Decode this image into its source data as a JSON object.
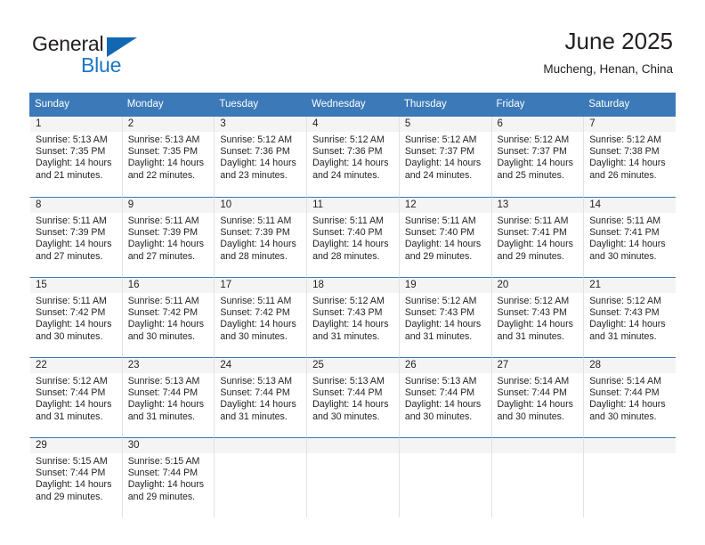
{
  "brand": {
    "name_top": "General",
    "name_bottom": "Blue",
    "top_color": "#231f20",
    "bottom_color": "#1b76c4",
    "triangle_color": "#1267b2",
    "icon": "triangle-flag-icon"
  },
  "header": {
    "title": "June 2025",
    "subtitle": "Mucheng, Henan, China"
  },
  "theme": {
    "header_bg": "#3b79b8",
    "header_text": "#ffffff",
    "daynum_bg": "#f4f4f4",
    "cell_bg": "#ffffff",
    "cell_border": "#e2e2e2",
    "week_border": "#3b79b8",
    "text": "#231f20"
  },
  "weekdays": [
    "Sunday",
    "Monday",
    "Tuesday",
    "Wednesday",
    "Thursday",
    "Friday",
    "Saturday"
  ],
  "weeks": [
    [
      {
        "day": "1",
        "sunrise": "Sunrise: 5:13 AM",
        "sunset": "Sunset: 7:35 PM",
        "daylight_1": "Daylight: 14 hours",
        "daylight_2": "and 21 minutes."
      },
      {
        "day": "2",
        "sunrise": "Sunrise: 5:13 AM",
        "sunset": "Sunset: 7:35 PM",
        "daylight_1": "Daylight: 14 hours",
        "daylight_2": "and 22 minutes."
      },
      {
        "day": "3",
        "sunrise": "Sunrise: 5:12 AM",
        "sunset": "Sunset: 7:36 PM",
        "daylight_1": "Daylight: 14 hours",
        "daylight_2": "and 23 minutes."
      },
      {
        "day": "4",
        "sunrise": "Sunrise: 5:12 AM",
        "sunset": "Sunset: 7:36 PM",
        "daylight_1": "Daylight: 14 hours",
        "daylight_2": "and 24 minutes."
      },
      {
        "day": "5",
        "sunrise": "Sunrise: 5:12 AM",
        "sunset": "Sunset: 7:37 PM",
        "daylight_1": "Daylight: 14 hours",
        "daylight_2": "and 24 minutes."
      },
      {
        "day": "6",
        "sunrise": "Sunrise: 5:12 AM",
        "sunset": "Sunset: 7:37 PM",
        "daylight_1": "Daylight: 14 hours",
        "daylight_2": "and 25 minutes."
      },
      {
        "day": "7",
        "sunrise": "Sunrise: 5:12 AM",
        "sunset": "Sunset: 7:38 PM",
        "daylight_1": "Daylight: 14 hours",
        "daylight_2": "and 26 minutes."
      }
    ],
    [
      {
        "day": "8",
        "sunrise": "Sunrise: 5:11 AM",
        "sunset": "Sunset: 7:39 PM",
        "daylight_1": "Daylight: 14 hours",
        "daylight_2": "and 27 minutes."
      },
      {
        "day": "9",
        "sunrise": "Sunrise: 5:11 AM",
        "sunset": "Sunset: 7:39 PM",
        "daylight_1": "Daylight: 14 hours",
        "daylight_2": "and 27 minutes."
      },
      {
        "day": "10",
        "sunrise": "Sunrise: 5:11 AM",
        "sunset": "Sunset: 7:39 PM",
        "daylight_1": "Daylight: 14 hours",
        "daylight_2": "and 28 minutes."
      },
      {
        "day": "11",
        "sunrise": "Sunrise: 5:11 AM",
        "sunset": "Sunset: 7:40 PM",
        "daylight_1": "Daylight: 14 hours",
        "daylight_2": "and 28 minutes."
      },
      {
        "day": "12",
        "sunrise": "Sunrise: 5:11 AM",
        "sunset": "Sunset: 7:40 PM",
        "daylight_1": "Daylight: 14 hours",
        "daylight_2": "and 29 minutes."
      },
      {
        "day": "13",
        "sunrise": "Sunrise: 5:11 AM",
        "sunset": "Sunset: 7:41 PM",
        "daylight_1": "Daylight: 14 hours",
        "daylight_2": "and 29 minutes."
      },
      {
        "day": "14",
        "sunrise": "Sunrise: 5:11 AM",
        "sunset": "Sunset: 7:41 PM",
        "daylight_1": "Daylight: 14 hours",
        "daylight_2": "and 30 minutes."
      }
    ],
    [
      {
        "day": "15",
        "sunrise": "Sunrise: 5:11 AM",
        "sunset": "Sunset: 7:42 PM",
        "daylight_1": "Daylight: 14 hours",
        "daylight_2": "and 30 minutes."
      },
      {
        "day": "16",
        "sunrise": "Sunrise: 5:11 AM",
        "sunset": "Sunset: 7:42 PM",
        "daylight_1": "Daylight: 14 hours",
        "daylight_2": "and 30 minutes."
      },
      {
        "day": "17",
        "sunrise": "Sunrise: 5:11 AM",
        "sunset": "Sunset: 7:42 PM",
        "daylight_1": "Daylight: 14 hours",
        "daylight_2": "and 30 minutes."
      },
      {
        "day": "18",
        "sunrise": "Sunrise: 5:12 AM",
        "sunset": "Sunset: 7:43 PM",
        "daylight_1": "Daylight: 14 hours",
        "daylight_2": "and 31 minutes."
      },
      {
        "day": "19",
        "sunrise": "Sunrise: 5:12 AM",
        "sunset": "Sunset: 7:43 PM",
        "daylight_1": "Daylight: 14 hours",
        "daylight_2": "and 31 minutes."
      },
      {
        "day": "20",
        "sunrise": "Sunrise: 5:12 AM",
        "sunset": "Sunset: 7:43 PM",
        "daylight_1": "Daylight: 14 hours",
        "daylight_2": "and 31 minutes."
      },
      {
        "day": "21",
        "sunrise": "Sunrise: 5:12 AM",
        "sunset": "Sunset: 7:43 PM",
        "daylight_1": "Daylight: 14 hours",
        "daylight_2": "and 31 minutes."
      }
    ],
    [
      {
        "day": "22",
        "sunrise": "Sunrise: 5:12 AM",
        "sunset": "Sunset: 7:44 PM",
        "daylight_1": "Daylight: 14 hours",
        "daylight_2": "and 31 minutes."
      },
      {
        "day": "23",
        "sunrise": "Sunrise: 5:13 AM",
        "sunset": "Sunset: 7:44 PM",
        "daylight_1": "Daylight: 14 hours",
        "daylight_2": "and 31 minutes."
      },
      {
        "day": "24",
        "sunrise": "Sunrise: 5:13 AM",
        "sunset": "Sunset: 7:44 PM",
        "daylight_1": "Daylight: 14 hours",
        "daylight_2": "and 31 minutes."
      },
      {
        "day": "25",
        "sunrise": "Sunrise: 5:13 AM",
        "sunset": "Sunset: 7:44 PM",
        "daylight_1": "Daylight: 14 hours",
        "daylight_2": "and 30 minutes."
      },
      {
        "day": "26",
        "sunrise": "Sunrise: 5:13 AM",
        "sunset": "Sunset: 7:44 PM",
        "daylight_1": "Daylight: 14 hours",
        "daylight_2": "and 30 minutes."
      },
      {
        "day": "27",
        "sunrise": "Sunrise: 5:14 AM",
        "sunset": "Sunset: 7:44 PM",
        "daylight_1": "Daylight: 14 hours",
        "daylight_2": "and 30 minutes."
      },
      {
        "day": "28",
        "sunrise": "Sunrise: 5:14 AM",
        "sunset": "Sunset: 7:44 PM",
        "daylight_1": "Daylight: 14 hours",
        "daylight_2": "and 30 minutes."
      }
    ],
    [
      {
        "day": "29",
        "sunrise": "Sunrise: 5:15 AM",
        "sunset": "Sunset: 7:44 PM",
        "daylight_1": "Daylight: 14 hours",
        "daylight_2": "and 29 minutes."
      },
      {
        "day": "30",
        "sunrise": "Sunrise: 5:15 AM",
        "sunset": "Sunset: 7:44 PM",
        "daylight_1": "Daylight: 14 hours",
        "daylight_2": "and 29 minutes."
      },
      {
        "day": "",
        "sunrise": "",
        "sunset": "",
        "daylight_1": "",
        "daylight_2": ""
      },
      {
        "day": "",
        "sunrise": "",
        "sunset": "",
        "daylight_1": "",
        "daylight_2": ""
      },
      {
        "day": "",
        "sunrise": "",
        "sunset": "",
        "daylight_1": "",
        "daylight_2": ""
      },
      {
        "day": "",
        "sunrise": "",
        "sunset": "",
        "daylight_1": "",
        "daylight_2": ""
      },
      {
        "day": "",
        "sunrise": "",
        "sunset": "",
        "daylight_1": "",
        "daylight_2": ""
      }
    ]
  ]
}
